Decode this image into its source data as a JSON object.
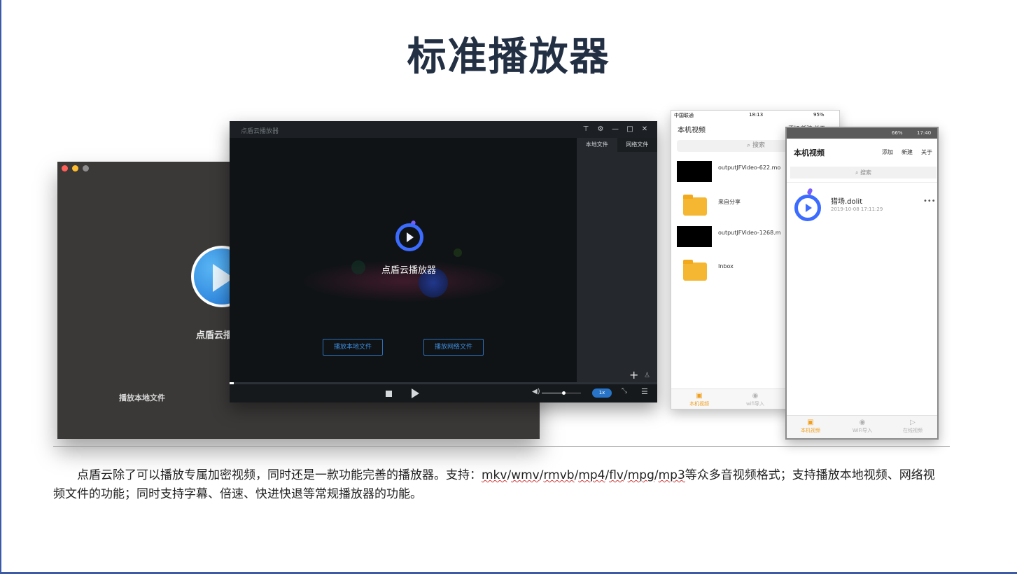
{
  "slide": {
    "title": "标准播放器",
    "description_prefix": "点盾云除了可以播放专属加密视频，同时还是一款功能完善的播放器。支持：",
    "formats": [
      "mkv",
      "wmv",
      "rmvb",
      "mp4",
      "flv",
      "mpg",
      "mp3"
    ],
    "description_suffix": "等众多音视频格式；支持播放本地视频、网络视频文件的功能；同时支持字幕、倍速、快进快退等常规播放器的功能。"
  },
  "mac_window": {
    "app_name": "点盾云播",
    "play_local_label": "播放本地文件",
    "dot_colors": [
      "#ff5f57",
      "#febc2e",
      "#8e8e8e"
    ]
  },
  "windows_player": {
    "title": "点盾云播放器",
    "app_name": "点盾云播放器",
    "play_local_button": "播放本地文件",
    "play_network_button": "播放网络文件",
    "side_tabs": [
      "本地文件",
      "网络文件"
    ],
    "progress": 0.01,
    "volume": 0.55,
    "speed": "1x",
    "accent": "#2874c8"
  },
  "ios_app": {
    "status_carrier": "中国联通",
    "status_time": "18:13",
    "status_battery": "95%",
    "header_title": "本机视频",
    "header_actions": "添加  新建  关于",
    "search_placeholder": "搜索",
    "items": [
      {
        "label": "outputJFVideo-622.mo",
        "kind": "video"
      },
      {
        "label": "来自分享",
        "kind": "folder"
      },
      {
        "label": "outputJFVideo-1268.m",
        "kind": "video"
      },
      {
        "label": "Inbox",
        "kind": "folder"
      }
    ],
    "tabs": [
      "本机视频",
      "wifi导入"
    ],
    "active_color": "#f0a020"
  },
  "android_app": {
    "status_battery": "66%",
    "status_time": "17:40",
    "header_title": "本机视频",
    "actions": [
      "添加",
      "新建",
      "关于"
    ],
    "search_placeholder": "搜索",
    "file": {
      "name": "猎场.dolit",
      "date": "2019-10-08 17:11:29"
    },
    "tabs": [
      "本机视频",
      "WiFi导入",
      "在线视频"
    ],
    "active_color": "#f0a020"
  }
}
